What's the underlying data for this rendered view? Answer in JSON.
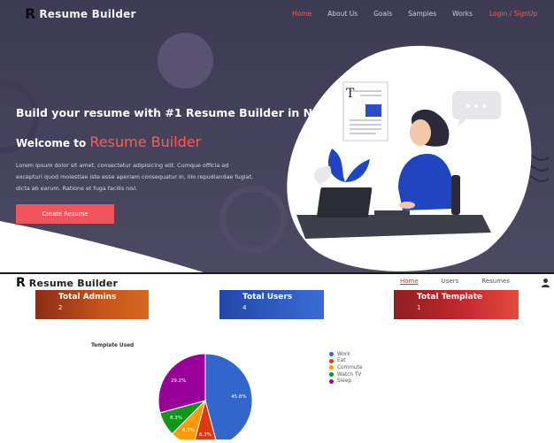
{
  "landing": {
    "brand_mark": "R",
    "brand_name": "Resume Builder",
    "nav": [
      {
        "label": "Home",
        "active": true
      },
      {
        "label": "About Us",
        "active": false
      },
      {
        "label": "Goals",
        "active": false
      },
      {
        "label": "Samples",
        "active": false
      },
      {
        "label": "Works",
        "active": false
      }
    ],
    "login_label": "Login / SignUp",
    "hero_title": "Build your resume with #1 Resume Builder in Nepal",
    "welcome_prefix": "Welcome to ",
    "welcome_accent": "Resume Builder",
    "description": "Lorem ipsum dolor sit amet, consectetur adipisicing elit. Cumque officia ad excepturi quod molestiae iste esse aperiam consequatur in, illo repudiandae fugiat, dicta ab earum. Ratione et fuga facilis nisi.",
    "cta_label": "Create Resume",
    "doc_letter": "T",
    "colors": {
      "accent": "#ff5a52",
      "background": "#3f3d55",
      "button": "#f2545b"
    }
  },
  "dashboard": {
    "brand_mark": "R",
    "brand_name": "Resume Builder",
    "nav": [
      {
        "label": "Home",
        "active": true
      },
      {
        "label": "Users",
        "active": false
      },
      {
        "label": "Resumes",
        "active": false
      }
    ],
    "avatar_icon": "user-avatar-icon",
    "stats": [
      {
        "label": "Total Admins",
        "count": "2"
      },
      {
        "label": "Total Users",
        "count": "4"
      },
      {
        "label": "Total Template",
        "count": "1"
      }
    ]
  },
  "chart_data": {
    "type": "pie",
    "title": "Template Used",
    "legend_position": "right",
    "categories": [
      "Work",
      "Eat",
      "Commute",
      "Watch TV",
      "Sleep"
    ],
    "values": [
      45.8,
      8.3,
      8.3,
      8.3,
      29.2
    ],
    "labels": [
      "45.8%",
      "8.3%",
      "8.3%",
      "8.3%",
      "29.2%"
    ],
    "colors": [
      "#3366cc",
      "#dc3912",
      "#ff9900",
      "#109618",
      "#990099"
    ]
  }
}
